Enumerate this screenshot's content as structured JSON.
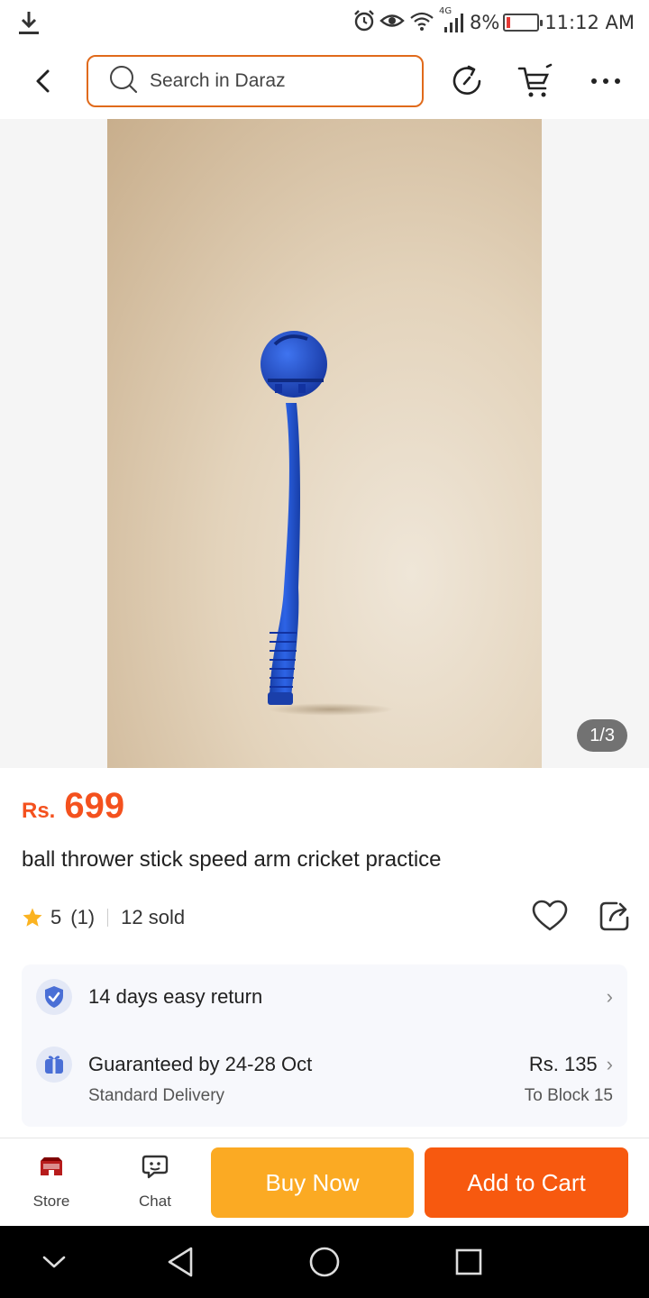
{
  "status_bar": {
    "battery": "8%",
    "network": "4G",
    "time": "11:12 AM"
  },
  "search": {
    "placeholder": "Search in Daraz"
  },
  "gallery": {
    "counter": "1/3"
  },
  "product": {
    "currency": "Rs.",
    "price": "699",
    "title": "ball thrower stick speed arm cricket practice",
    "rating": "5",
    "reviews": "(1)",
    "sold": "12 sold"
  },
  "services": {
    "return_label": "14 days easy return",
    "delivery_label": "Guaranteed by 24-28 Oct",
    "delivery_type": "Standard Delivery",
    "delivery_fee": "Rs. 135",
    "delivery_location": "To Block 15"
  },
  "action_bar": {
    "store_label": "Store",
    "chat_label": "Chat",
    "buy_now": "Buy Now",
    "add_to_cart": "Add to Cart"
  },
  "colors": {
    "accent_orange": "#f7590f",
    "buy_now_yellow": "#fbaa23",
    "price_orange": "#f4511e",
    "search_border": "#e06a1b",
    "product_blue": "#1f4fd1"
  },
  "icons": [
    "download-icon",
    "alarm-icon",
    "eye-icon",
    "wifi-icon",
    "signal-icon",
    "battery-icon",
    "back-icon",
    "search-icon",
    "history-icon",
    "cart-icon",
    "more-icon",
    "star-icon",
    "heart-icon",
    "share-icon",
    "shield-check-icon",
    "gift-icon",
    "chevron-right-icon",
    "store-icon",
    "chat-icon",
    "nav-down-icon",
    "nav-back-icon",
    "nav-home-icon",
    "nav-recents-icon"
  ]
}
